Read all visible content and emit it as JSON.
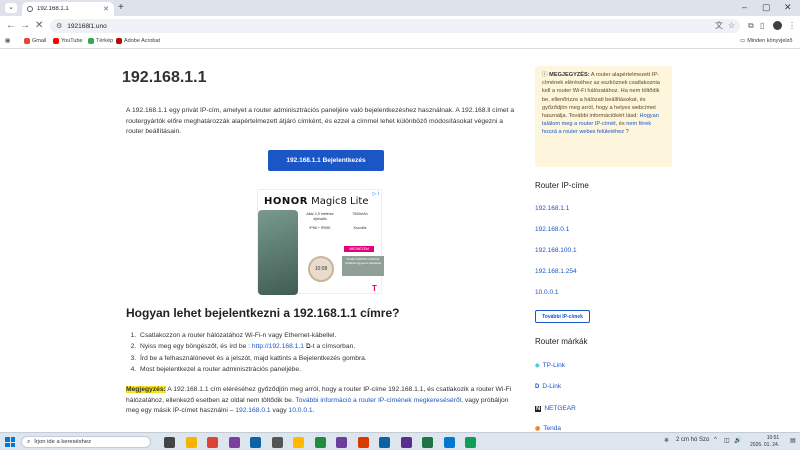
{
  "browser": {
    "tab_title": "192.168.1.1",
    "url": "192168l1.uno",
    "new_tab": "+",
    "tab_close": "✕"
  },
  "bookmarks": [
    {
      "label": "Gmail",
      "color": "#ea4335"
    },
    {
      "label": "YouTube",
      "color": "#ff0000"
    },
    {
      "label": "Térkép",
      "color": "#34a853"
    },
    {
      "label": "Adobe Acrobat",
      "color": "#b30b00"
    }
  ],
  "bookmarks_all": "Minden könyvjelző",
  "page": {
    "title": "192.168.1.1",
    "intro": "A 192.168.1.1 egy privát IP-cím, amelyet a router adminisztrációs paneljére való bejelentkezéshez használnak. A 192.168.ll címet a routergyártók előre meghatározzák alapértelmezett átjáró címként, és ezzel a címmel lehet különböző módosításokat végezni a router beállításain.",
    "login_button": "192.168.1.1 Bejelentkezés",
    "ad": {
      "brand": "HONOR",
      "model": "Magic8 Lite",
      "spec1": "Akár 2,5 méteres ejtésálló",
      "spec2": "7500mAh",
      "spec3": "IP68 + IP69K",
      "spec4": "Kurzális",
      "cta": "MEGNÉZEM",
      "box": "Kiváló HONOR CHOICE Csillada ingyenes tökéletes",
      "time": "10:08",
      "adchoice": "▷ i"
    },
    "howto_heading": "Hogyan lehet bejelentkezni a 192.168.1.1 címre?",
    "steps": [
      "Csatlakozzon a router hálózatához Wi-Fi-n vagy Ethernet-kábellel.",
      "Nyiss meg egy böngészőt, és írd be :",
      "Írd be a felhasználónevet és a jelszót, majd kattints a Bejelentkezés gombra.",
      "Most bejelentkezel a router adminisztrációs paneljébe."
    ],
    "step2_link": "http://192.168.1.1",
    "step2_after": "-t a címsorban.",
    "note_label": "Megjegyzés:",
    "note_text1": "A 192.168.1.1 cím eléréséhez győződjön meg arról, hogy a router IP-címe 192.168.1.1, és csatlakozik a router Wi-Fi hálózatához, ellenkező esetben az oldal nem töltődik be.",
    "note_link1": "További információ a router IP-címének megkereséséről",
    "note_text2": ", vagy próbáljon meg egy másik IP-címet használni –",
    "note_link2": "192.168.0.1",
    "note_text3": "vagy",
    "note_link3": "10.0.0.1",
    "note_end": "."
  },
  "sidebar": {
    "notebox_label": "MEGJEGYZÉS:",
    "notebox_text": "A router alapértelmezett IP-címének eléréséhez az eszköznek csatlakoznia kell a router Wi-Fi hálózatához. Ha nem töltődik be, ellenőrizze a hálózati beállításokat, és győződjön meg arról, hogy a helyes webcímet használja. További információkért lásd:",
    "notebox_link1": "Hogyan találom meg a router IP-címét",
    "notebox_mid": ", és",
    "notebox_link2": "nem férek hozzá a router webes felületéhez",
    "notebox_end": "?",
    "ip_heading": "Router IP-címe",
    "ips": [
      "192.168.1.1",
      "192.168.0.1",
      "192.168.100.1",
      "192.168.1.254",
      "10.0.0.1"
    ],
    "more_ip_button": "További IP-címek",
    "brands_heading": "Router márkák",
    "brands": [
      {
        "icon": "tp-link-icon",
        "glyph": "◆",
        "label": "TP-Link",
        "color": "#4acbd6"
      },
      {
        "icon": "d-link-icon",
        "glyph": "D",
        "label": "D-Link",
        "color": "#1a56c6"
      },
      {
        "icon": "netgear-icon",
        "glyph": "N",
        "label": "NETGEAR",
        "color": "#222222"
      },
      {
        "icon": "tenda-icon",
        "glyph": "◉",
        "label": "Tenda",
        "color": "#f07c1f"
      }
    ]
  },
  "taskbar": {
    "search_placeholder": "Írjon ide a kereséshez",
    "weather": "2 cm hó Szo",
    "time": "10:51",
    "date": "2026. 01. 24.",
    "apps": [
      "#444",
      "#f4b400",
      "#db4437",
      "#7b3fa0",
      "#0a64a4",
      "#555",
      "#ffb900",
      "#1e8e3e",
      "#6c3f9e",
      "#d83b01",
      "#0a64a4",
      "#5c2d91",
      "#217346",
      "#0078d4",
      "#0f9d58"
    ]
  }
}
